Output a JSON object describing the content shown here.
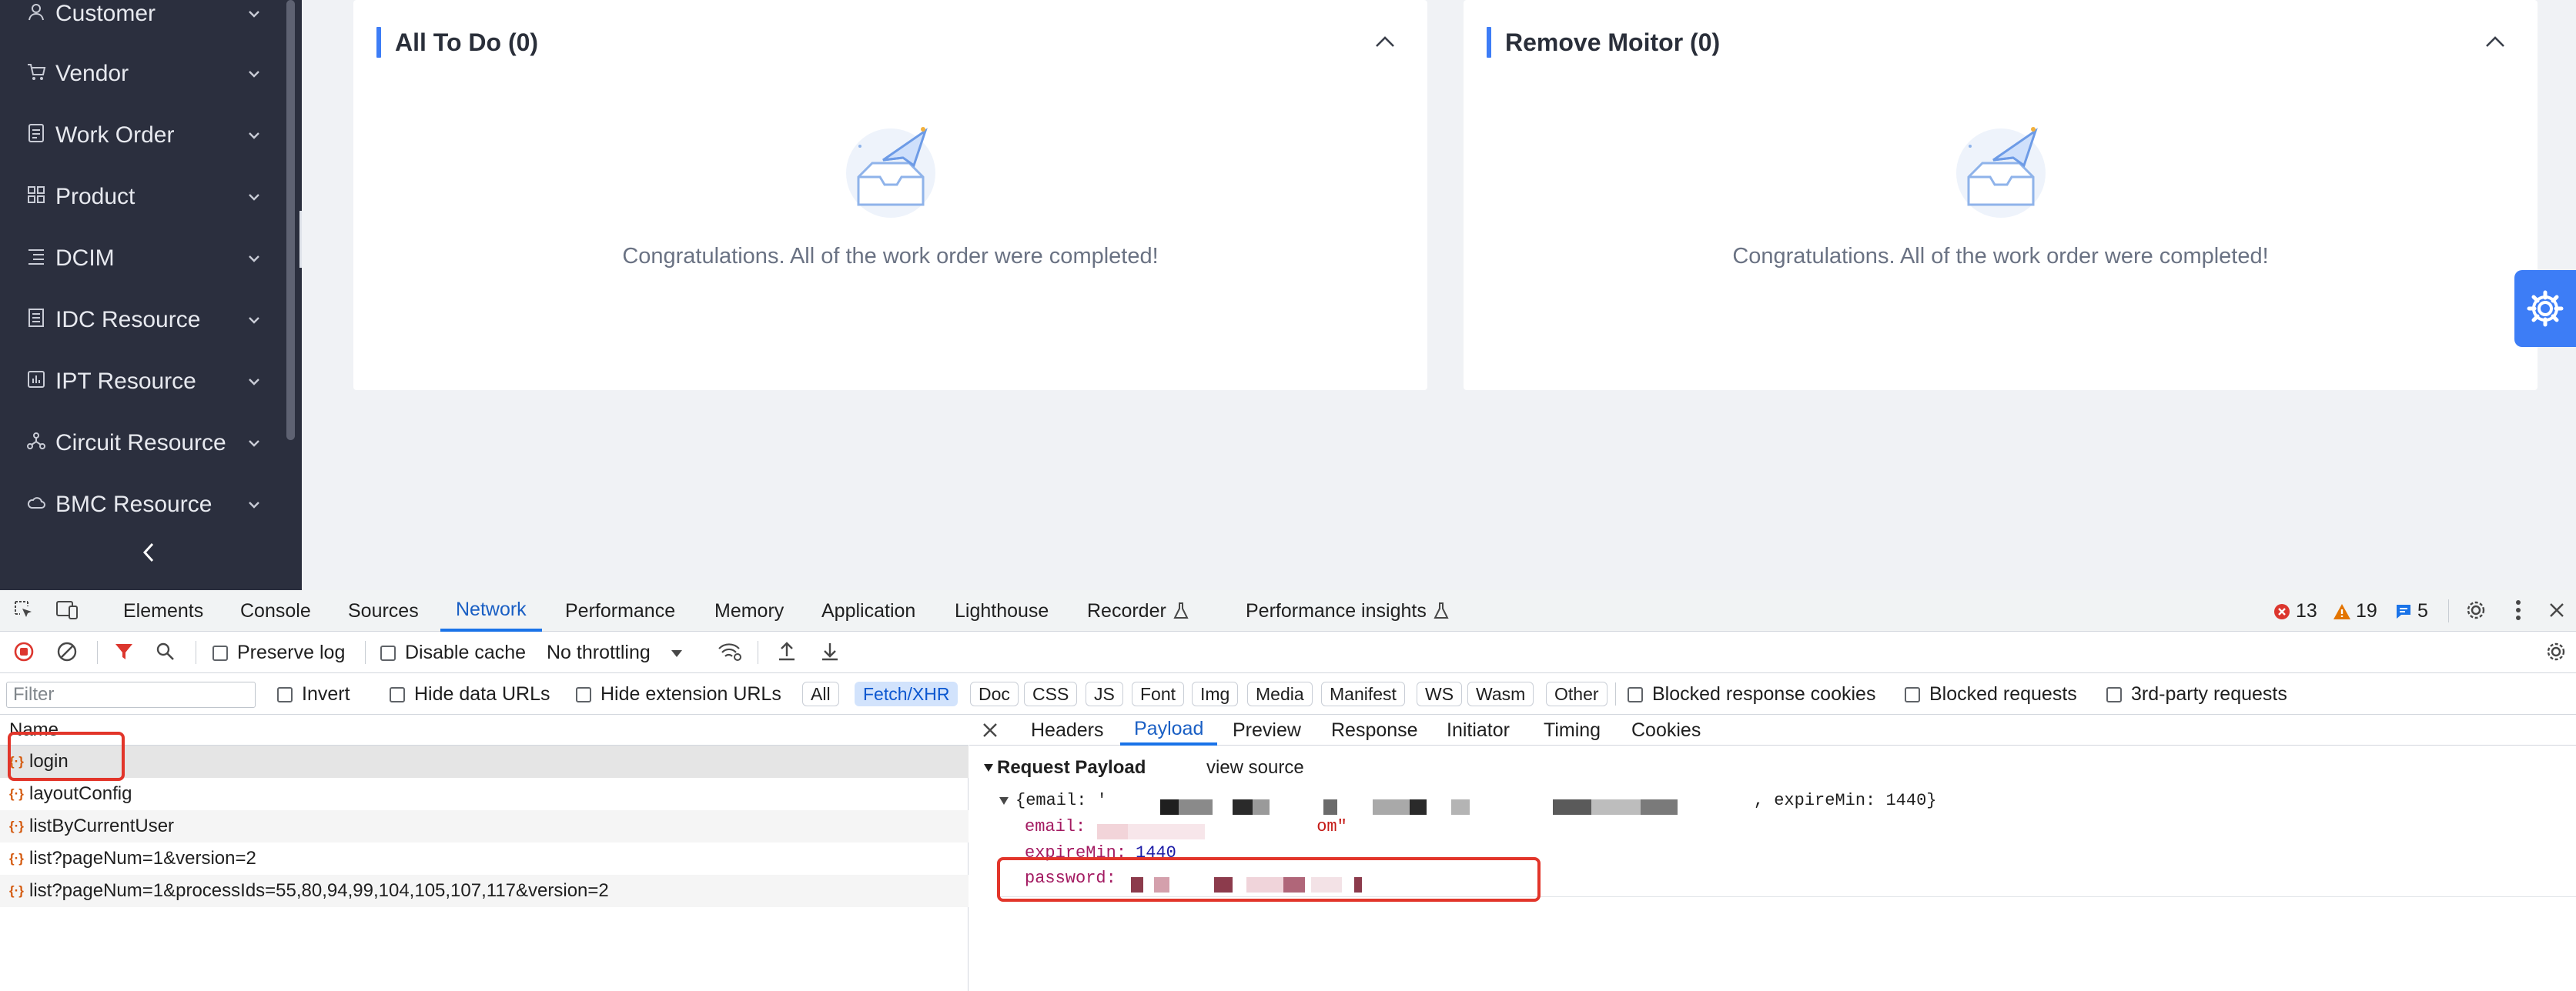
{
  "sidebar": {
    "items": [
      {
        "label": "Customer",
        "icon": "user-icon"
      },
      {
        "label": "Vendor",
        "icon": "cart-icon"
      },
      {
        "label": "Work Order",
        "icon": "document-icon"
      },
      {
        "label": "Product",
        "icon": "grid-icon"
      },
      {
        "label": "DCIM",
        "icon": "list-icon"
      },
      {
        "label": "IDC Resource",
        "icon": "building-icon"
      },
      {
        "label": "IPT Resource",
        "icon": "chart-icon"
      },
      {
        "label": "Circuit Resource",
        "icon": "network-icon"
      },
      {
        "label": "BMC Resource",
        "icon": "cloud-icon"
      }
    ]
  },
  "cards": [
    {
      "title": "All To Do (0)",
      "message": "Congratulations. All of the work order were completed!"
    },
    {
      "title": "Remove Moitor (0)",
      "message": "Congratulations. All of the work order were completed!"
    }
  ],
  "devtools": {
    "tabs": [
      "Elements",
      "Console",
      "Sources",
      "Network",
      "Performance",
      "Memory",
      "Application",
      "Lighthouse",
      "Recorder",
      "Performance insights"
    ],
    "active_tab": "Network",
    "status": {
      "errors": "13",
      "warnings": "19",
      "messages": "5"
    },
    "toolbar": {
      "preserve_log": "Preserve log",
      "disable_cache": "Disable cache",
      "throttling": "No throttling"
    },
    "filter": {
      "placeholder": "Filter",
      "invert": "Invert",
      "hide_data_urls": "Hide data URLs",
      "hide_extension_urls": "Hide extension URLs",
      "chips": [
        "All",
        "Fetch/XHR",
        "Doc",
        "CSS",
        "JS",
        "Font",
        "Img",
        "Media",
        "Manifest",
        "WS",
        "Wasm",
        "Other"
      ],
      "active_chip": "Fetch/XHR",
      "blocked_response_cookies": "Blocked response cookies",
      "blocked_requests": "Blocked requests",
      "third_party": "3rd-party requests"
    },
    "requests": {
      "header": "Name",
      "rows": [
        "login",
        "layoutConfig",
        "listByCurrentUser",
        "list?pageNum=1&version=2",
        "list?pageNum=1&processIds=55,80,94,99,104,105,107,117&version=2"
      ]
    },
    "detail": {
      "tabs": [
        "Headers",
        "Payload",
        "Preview",
        "Response",
        "Initiator",
        "Timing",
        "Cookies"
      ],
      "active_tab": "Payload",
      "section_title": "Request Payload",
      "view_source": "view source",
      "summary_prefix": "{email: '",
      "summary_suffix": ", expireMin: 1440}",
      "email_key": "email:",
      "email_tail": "om\"",
      "expire_key": "expireMin:",
      "expire_val": "1440",
      "password_key": "password:"
    }
  },
  "colors": {
    "accent": "#3d7df6",
    "sidebar_bg": "#2b2f3e",
    "devtools_blue": "#1a73e8",
    "annotation_red": "#e2352a"
  }
}
